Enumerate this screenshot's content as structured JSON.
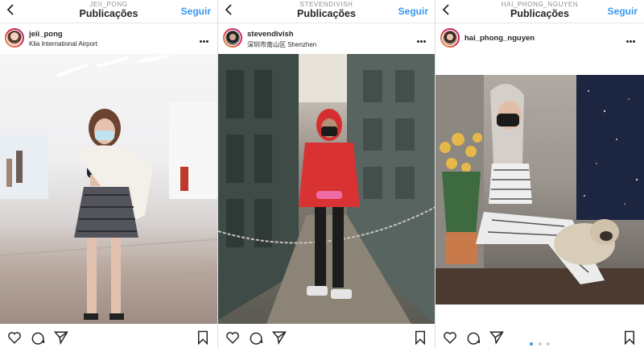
{
  "panels": [
    {
      "username_caps": "JEII_PONG",
      "title": "Publicações",
      "follow_label": "Seguir",
      "username": "jeii_pong",
      "location": "Klia International Airport"
    },
    {
      "username_caps": "STEVENDIVISH",
      "title": "Publicações",
      "follow_label": "Seguir",
      "username": "stevendivish",
      "location": "深圳市南山区 Shenzhen"
    },
    {
      "username_caps": "HAI_PHONG_NGUYEN",
      "title": "Publicações",
      "follow_label": "Seguir",
      "username": "hai_phong_nguyen",
      "location": ""
    }
  ],
  "icons": {
    "back": "chevron-left-icon",
    "more": "more-horizontal-icon",
    "like": "heart-icon",
    "comment": "comment-icon",
    "share": "send-icon",
    "save": "bookmark-icon"
  },
  "carousel": {
    "count": 3,
    "active": 1
  },
  "colors": {
    "accent": "#3897f0",
    "text": "#262626",
    "muted": "#8e8e8e"
  }
}
